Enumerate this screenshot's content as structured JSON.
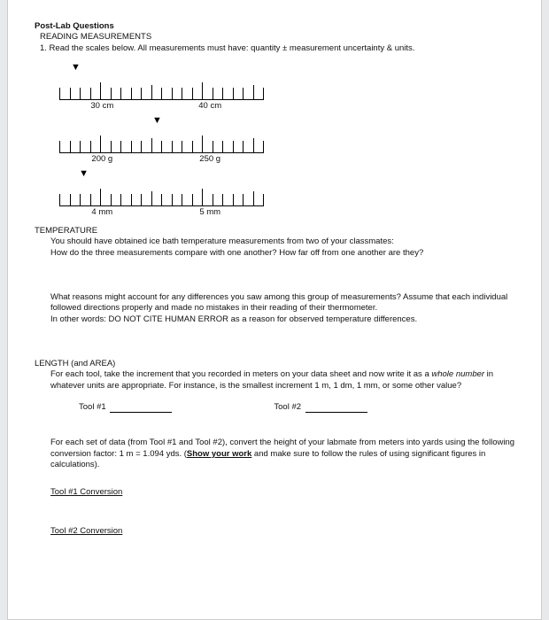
{
  "header": {
    "title": "Post-Lab Questions",
    "subtitle": "READING MEASUREMENTS",
    "q1": "1.   Read the scales below. All measurements must have: quantity ± measurement uncertainty & units."
  },
  "rulers": [
    {
      "left_label": "30 cm",
      "right_label": "40 cm",
      "left_label_pos_pct": 21,
      "right_label_pos_pct": 74,
      "arrow_pos_pct": 8,
      "divisions": 20,
      "majors": [
        4,
        14
      ],
      "halves": [
        9,
        19
      ],
      "leading_ticks": 0
    },
    {
      "left_label": "200 g",
      "right_label": "250 g",
      "left_label_pos_pct": 21,
      "right_label_pos_pct": 74,
      "arrow_pos_pct": 48,
      "divisions": 20,
      "majors": [
        4,
        14
      ],
      "halves": [
        9,
        19
      ],
      "leading_ticks": 0
    },
    {
      "left_label": "4 mm",
      "right_label": "5 mm",
      "left_label_pos_pct": 21,
      "right_label_pos_pct": 74,
      "arrow_pos_pct": 12,
      "divisions": 20,
      "majors": [
        4,
        14
      ],
      "halves": [
        9,
        19
      ],
      "leading_ticks": 0
    }
  ],
  "temperature": {
    "heading": "TEMPERATURE",
    "p1a": "You should have obtained ice bath temperature measurements from two of your classmates:",
    "p1b": "How do the three measurements compare with one another?  How far off from one another are they?",
    "p2a": "What reasons might account for any differences you saw among this group of measurements?  Assume that each individual followed directions properly and made no mistakes in their reading of their thermometer.",
    "p2b": "In other words: DO NOT CITE HUMAN ERROR as a reason for observed temperature differences."
  },
  "length": {
    "heading": "LENGTH (and AREA)",
    "intro_a": "For each tool, take the increment that you recorded in meters on your data sheet and now write it as a ",
    "intro_italic": "whole number",
    "intro_b": " in whatever units are appropriate.  For instance, is the smallest increment 1 m, 1 dm, 1 mm, or some other value?",
    "tool1_label": "Tool #1",
    "tool2_label": "Tool #2",
    "conv_intro_a": "For each set of data (from Tool #1 and Tool #2), convert the height of your labmate from meters into yards using the following conversion factor: 1 m = 1.094 yds.  (",
    "conv_intro_link": "Show your work",
    "conv_intro_b": " and make sure to follow the rules of using significant figures in calculations).",
    "conv1": "Tool #1 Conversion",
    "conv2": "Tool #2 Conversion"
  }
}
